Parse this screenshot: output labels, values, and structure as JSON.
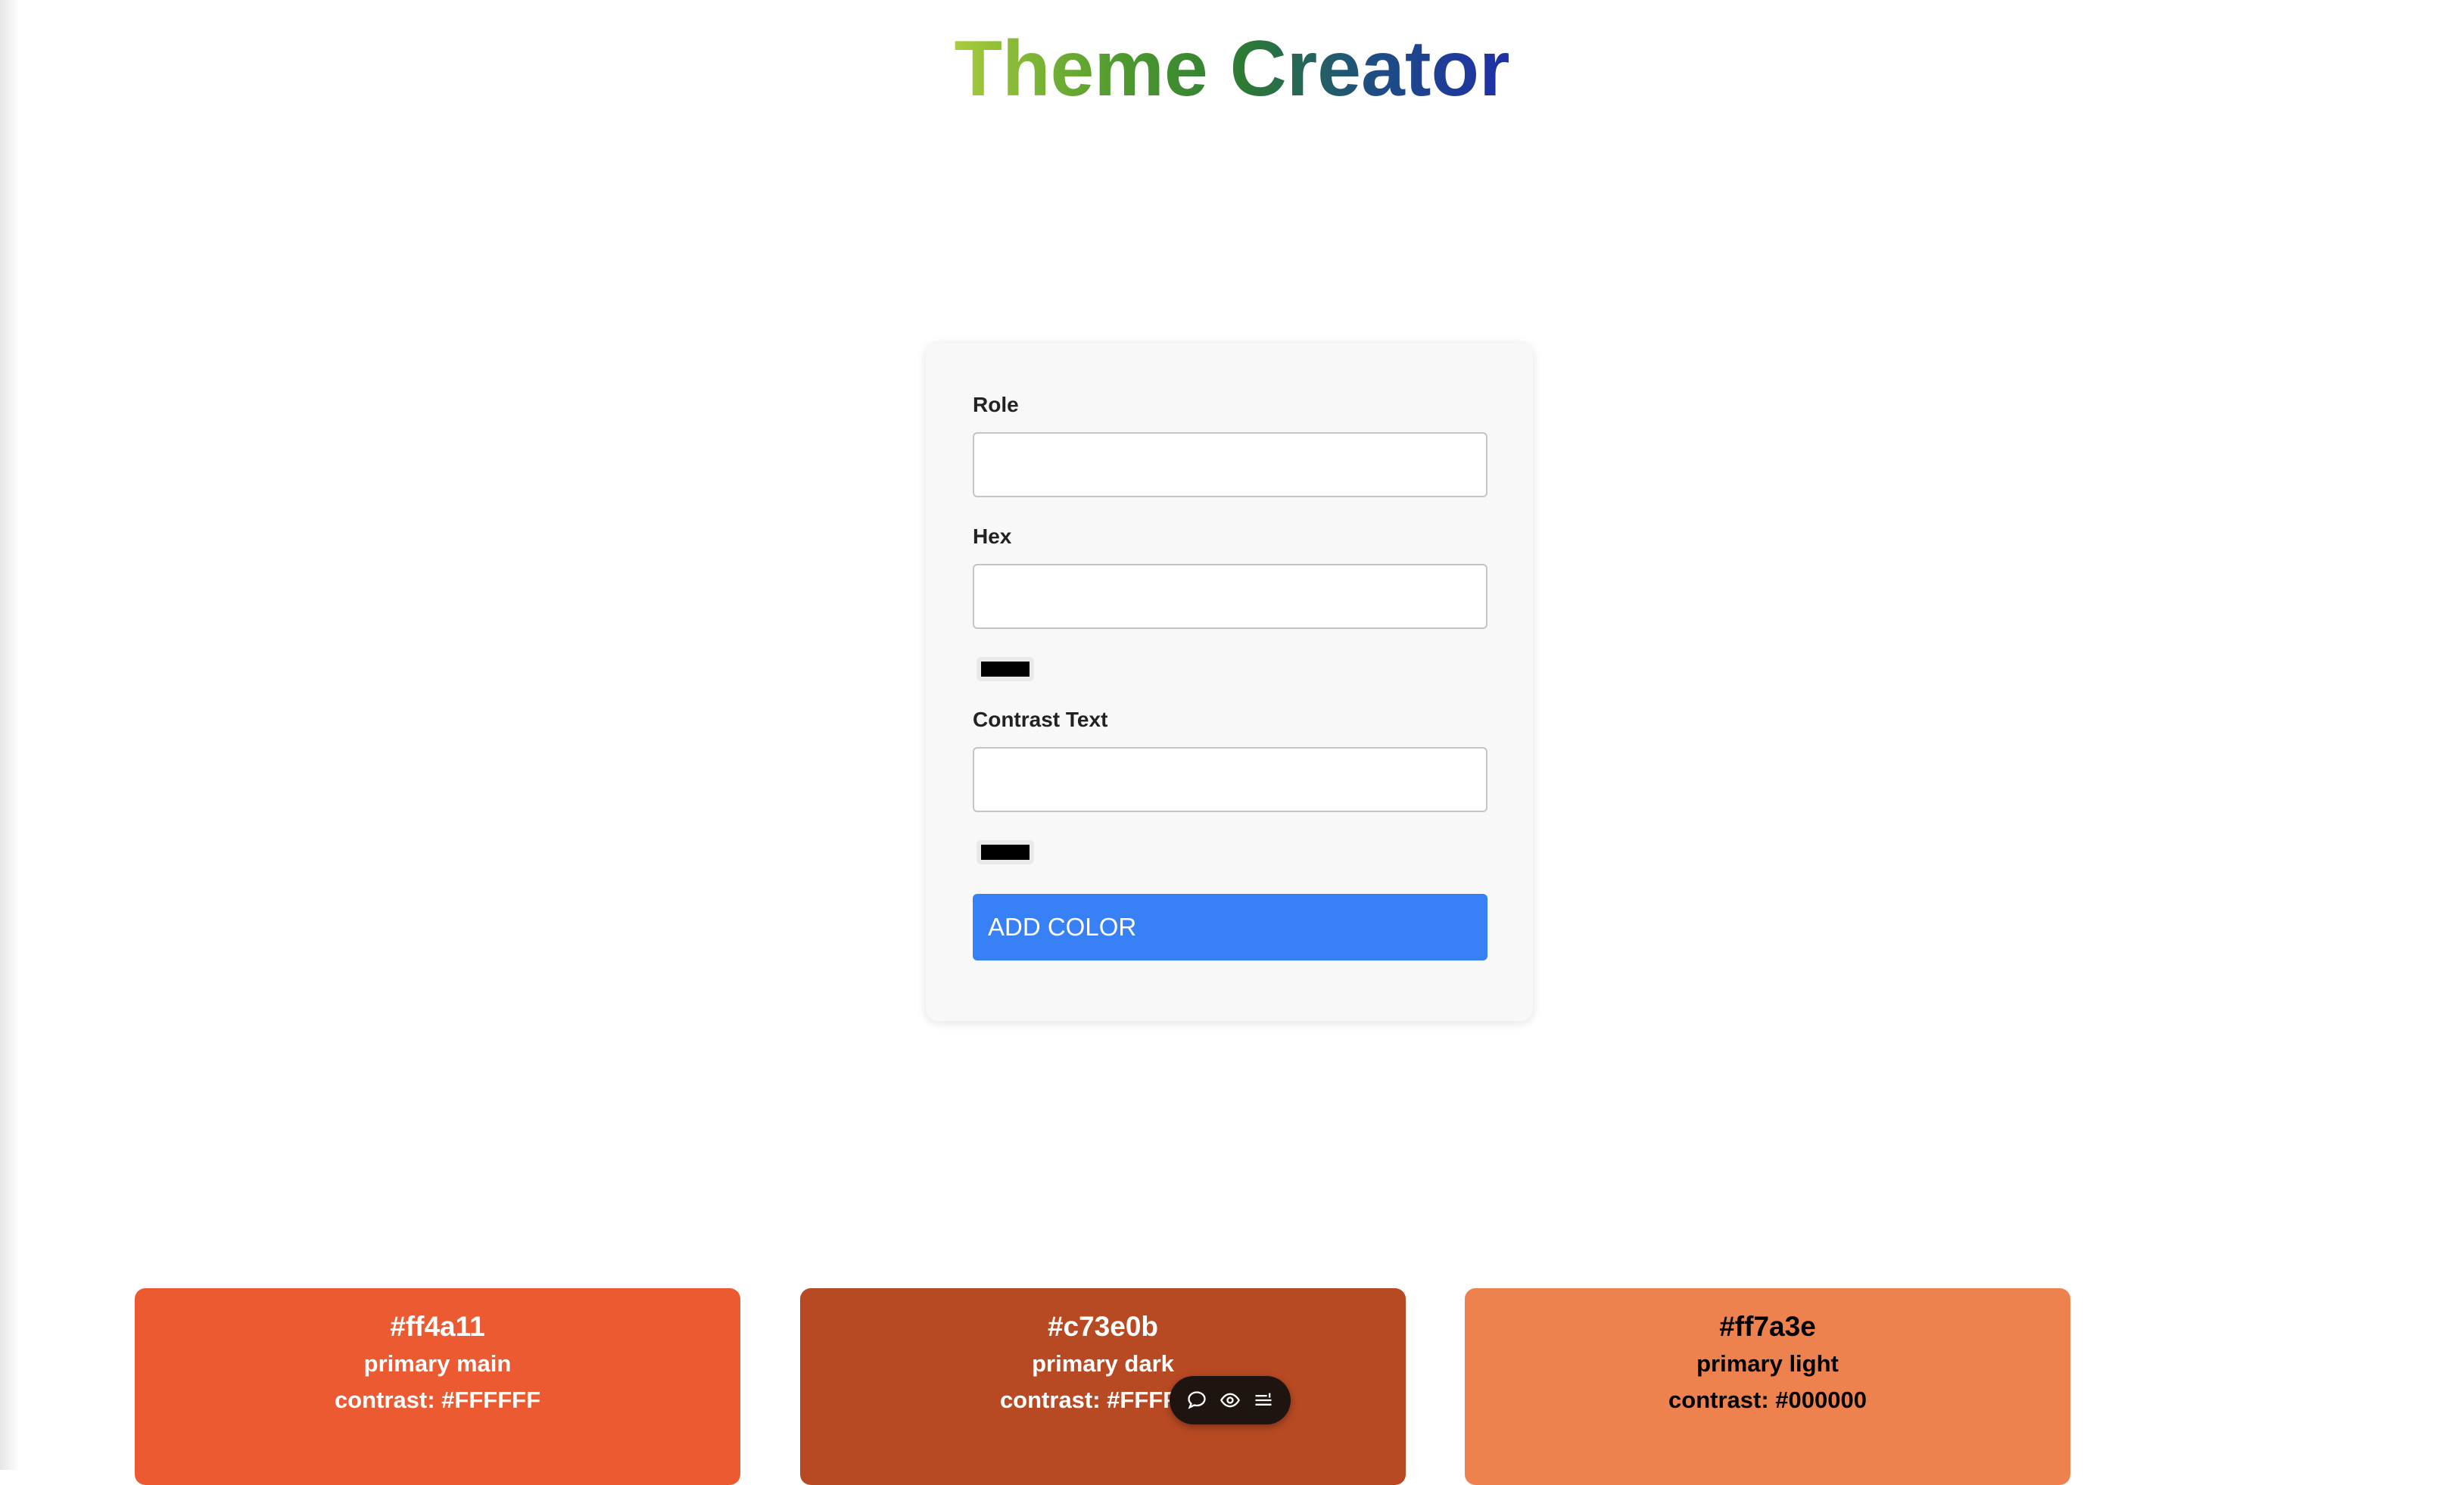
{
  "header": {
    "title": "Theme Creator"
  },
  "form": {
    "role_label": "Role",
    "role_value": "",
    "hex_label": "Hex",
    "hex_value": "",
    "hex_swatch_color": "#000000",
    "contrast_label": "Contrast Text",
    "contrast_value": "",
    "contrast_swatch_color": "#000000",
    "submit_label": "ADD COLOR",
    "submit_color": "#3780f5"
  },
  "colors": [
    {
      "hex": "#ff4a11",
      "role": "primary main",
      "contrast_text": "contrast: #FFFFFF",
      "bg": "#eb5a30",
      "fg": "#ffffff"
    },
    {
      "hex": "#c73e0b",
      "role": "primary dark",
      "contrast_text": "contrast: #FFFFFF",
      "bg": "#b84a23",
      "fg": "#ffffff"
    },
    {
      "hex": "#ff7a3e",
      "role": "primary light",
      "contrast_text": "contrast: #000000",
      "bg": "#ee824f",
      "fg": "#000000"
    }
  ],
  "toolbar": {
    "icons": [
      "comment-icon",
      "eye-icon",
      "menu-list-icon"
    ]
  }
}
